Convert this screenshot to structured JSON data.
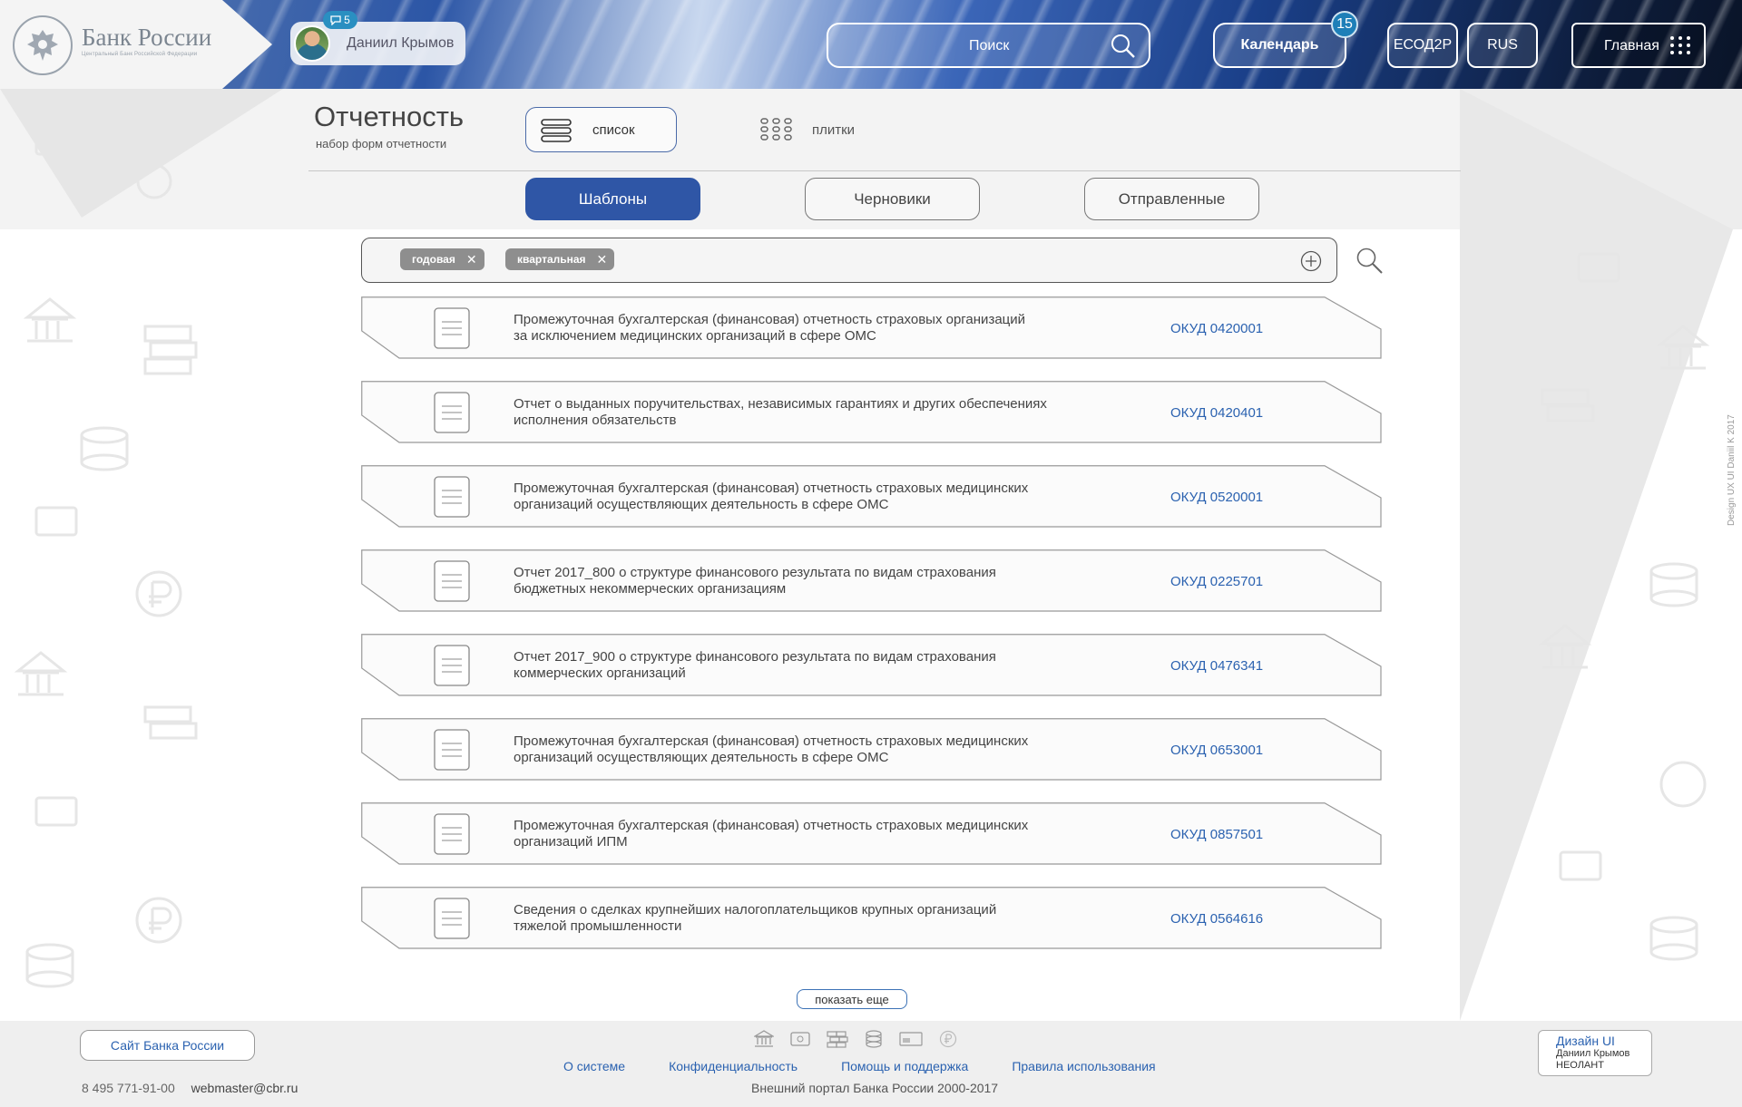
{
  "header": {
    "bank_name": "Банк России",
    "bank_subtitle": "Центральный Банк Российской Федерации",
    "user": {
      "name": "Даниил Крымов",
      "notifications": "5"
    },
    "search_label": "Поиск",
    "calendar_label": "Календарь",
    "calendar_badge": "15",
    "ecod_label": "ЕСОД2Р",
    "lang_label": "RUS",
    "home_label": "Главная"
  },
  "page": {
    "title": "Отчетность",
    "subtitle": "набор форм отчетности",
    "view_list_label": "список",
    "view_tiles_label": "плитки"
  },
  "tabs": [
    {
      "label": "Шаблоны",
      "active": true
    },
    {
      "label": "Черновики",
      "active": false
    },
    {
      "label": "Отправленные",
      "active": false
    }
  ],
  "filters": [
    {
      "label": "годовая"
    },
    {
      "label": "квартальная"
    }
  ],
  "items": [
    {
      "line1": "Промежуточная бухгалтерская (финансовая) отчетность страховых организаций",
      "line2": "за исключением медицинских организаций в сфере ОМС",
      "code": "ОКУД 0420001"
    },
    {
      "line1": "Отчет о выданных поручительствах, независимых гарантиях и других обеспечениях",
      "line2": "исполнения обязательств",
      "code": "ОКУД 0420401"
    },
    {
      "line1": "Промежуточная бухгалтерская (финансовая) отчетность страховых медицинских",
      "line2": "организаций осуществляющих деятельность в сфере ОМС",
      "code": "ОКУД 0520001"
    },
    {
      "line1": "Отчет 2017_800 о структуре финансового результата по видам страхования",
      "line2": "бюджетных некоммерческих организациям",
      "code": "ОКУД 0225701"
    },
    {
      "line1": "Отчет 2017_900 о структуре финансового результата по видам страхования",
      "line2": "коммерческих организаций",
      "code": "ОКУД 0476341"
    },
    {
      "line1": "Промежуточная бухгалтерская (финансовая) отчетность страховых медицинских",
      "line2": "организаций осуществляющих деятельность в сфере ОМС",
      "code": "ОКУД 0653001"
    },
    {
      "line1": "Промежуточная бухгалтерская (финансовая) отчетность страховых медицинских",
      "line2": "организаций  ИПМ",
      "code": "ОКУД 0857501"
    },
    {
      "line1": "Сведения о сделках крупнейших налогоплательщиков крупных организаций",
      "line2": "тяжелой промышленности",
      "code": "ОКУД 0564616"
    }
  ],
  "show_more_label": "показать еще",
  "side_credit": "Design UX UI Daniil K 2017",
  "footer": {
    "site_button": "Сайт Банка России",
    "phone": "8 495 771-91-00",
    "email": "webmaster@cbr.ru",
    "links": [
      "О системе",
      "Конфиденциальность",
      "Помощь и поддержка",
      "Правила использования"
    ],
    "copyright": "Внешний портал Банка России 2000-2017",
    "design_title": "Дизайн UI",
    "design_author": "Даниил Крымов",
    "design_company": "НЕОЛАНТ"
  },
  "colors": {
    "accent": "#2f56a6",
    "link": "#2b62b0",
    "badge": "#2a8fc1"
  },
  "icons": [
    "bank-icon",
    "card-icon",
    "bricks-icon",
    "coins-icon",
    "id-card-icon",
    "ruble-icon",
    "search-icon",
    "list-icon",
    "grid-icon",
    "add-circle-icon",
    "document-icon",
    "close-icon",
    "chat-icon"
  ]
}
